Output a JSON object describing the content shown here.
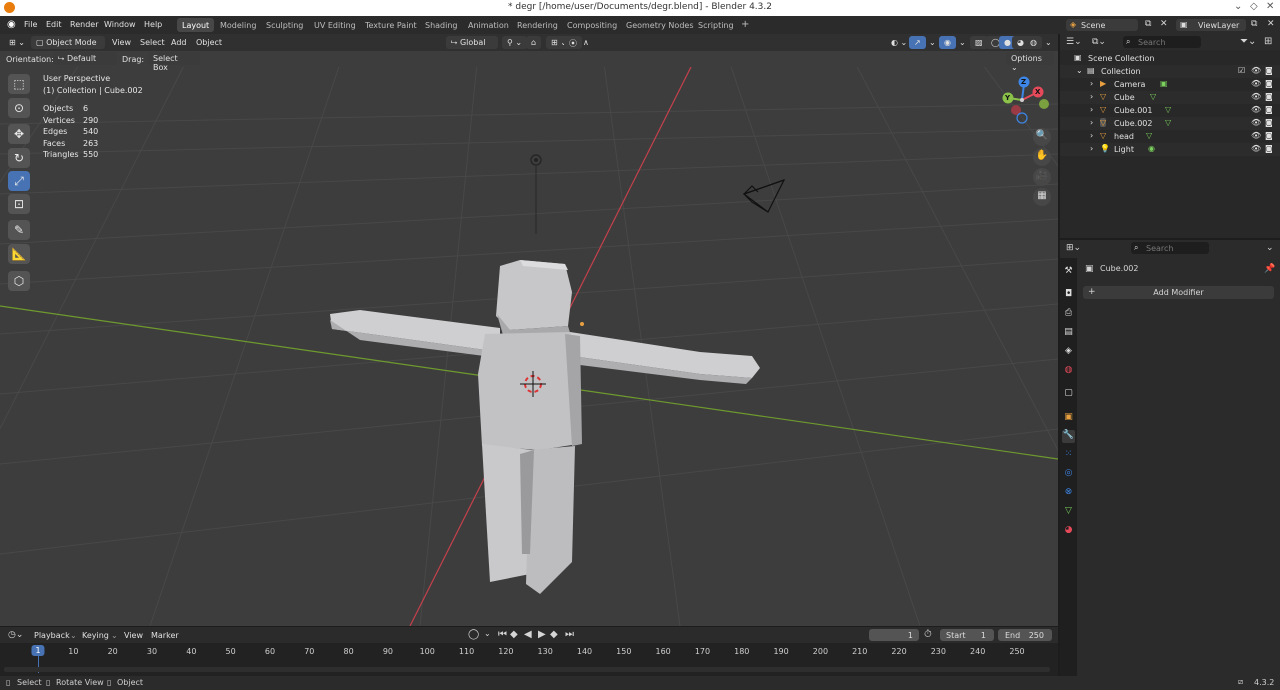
{
  "window": {
    "title": "* degr [/home/user/Documents/degr.blend] - Blender 4.3.2"
  },
  "menu": [
    "File",
    "Edit",
    "Render",
    "Window",
    "Help"
  ],
  "workspaces": [
    {
      "label": "Layout",
      "active": true
    },
    {
      "label": "Modeling"
    },
    {
      "label": "Sculpting"
    },
    {
      "label": "UV Editing"
    },
    {
      "label": "Texture Paint"
    },
    {
      "label": "Shading"
    },
    {
      "label": "Animation"
    },
    {
      "label": "Rendering"
    },
    {
      "label": "Compositing"
    },
    {
      "label": "Geometry Nodes"
    },
    {
      "label": "Scripting"
    }
  ],
  "add_workspace": "+",
  "scene": {
    "label": "Scene",
    "view_layer": "ViewLayer"
  },
  "viewport_header": {
    "mode": "Object Mode",
    "menus": [
      "View",
      "Select",
      "Add",
      "Object"
    ],
    "transform": "Global"
  },
  "tool_header": {
    "orientation_label": "Orientation:",
    "orientation_value": "Default",
    "drag_label": "Drag:",
    "drag_value": "Select Box",
    "options": "Options"
  },
  "overlay_info": {
    "perspective": "User Perspective",
    "collection": "(1) Collection | Cube.002",
    "stats": [
      {
        "label": "Objects",
        "value": "6"
      },
      {
        "label": "Vertices",
        "value": "290"
      },
      {
        "label": "Edges",
        "value": "540"
      },
      {
        "label": "Faces",
        "value": "263"
      },
      {
        "label": "Triangles",
        "value": "550"
      }
    ]
  },
  "gizmo": {
    "x": "X",
    "y": "Y",
    "z": "Z"
  },
  "colors": {
    "accent": "#4772b3",
    "x_axis": "#e64a5a",
    "y_axis": "#8bc34a",
    "z_axis": "#3d86e6",
    "object_orange": "#e8a040",
    "mesh_green": "#7ad05c"
  },
  "outliner": {
    "search_placeholder": "Search",
    "root": "Scene Collection",
    "collection": "Collection",
    "items": [
      {
        "name": "Camera",
        "icon": "camera-icon"
      },
      {
        "name": "Cube",
        "icon": "mesh-icon"
      },
      {
        "name": "Cube.001",
        "icon": "mesh-icon"
      },
      {
        "name": "Cube.002",
        "icon": "mesh-icon",
        "selected": true
      },
      {
        "name": "head",
        "icon": "mesh-icon"
      },
      {
        "name": "Light",
        "icon": "light-icon"
      }
    ]
  },
  "properties": {
    "search_placeholder": "Search",
    "object_name": "Cube.002",
    "add_modifier": "Add Modifier"
  },
  "timeline": {
    "menus": [
      "Playback",
      "Keying",
      "View",
      "Marker"
    ],
    "current_frame": "1",
    "start_label": "Start",
    "start_value": "1",
    "end_label": "End",
    "end_value": "250",
    "ticks": [
      "1",
      "10",
      "20",
      "30",
      "40",
      "50",
      "60",
      "70",
      "80",
      "90",
      "100",
      "110",
      "120",
      "130",
      "140",
      "150",
      "160",
      "170",
      "180",
      "190",
      "200",
      "210",
      "220",
      "230",
      "240",
      "250"
    ]
  },
  "statusbar": {
    "items": [
      "Select",
      "Rotate View",
      "Object"
    ],
    "version": "4.3.2"
  }
}
